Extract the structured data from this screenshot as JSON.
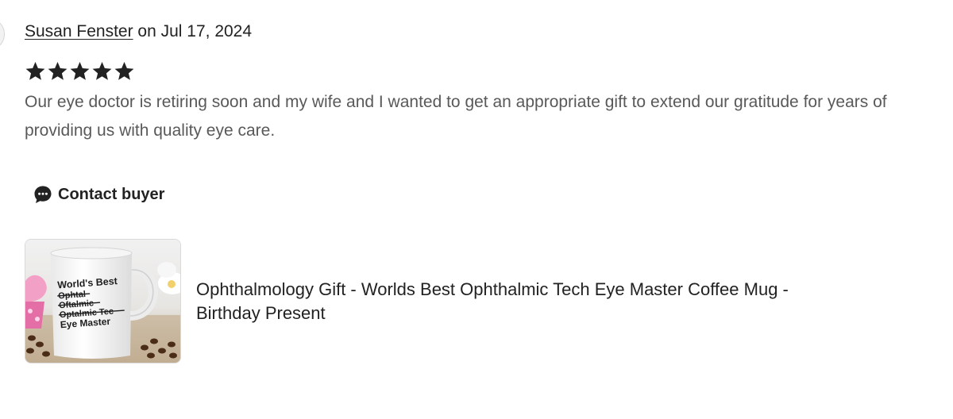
{
  "review": {
    "reviewer_name": "Susan Fenster",
    "date_prefix": " on ",
    "date": "Jul 17, 2024",
    "rating": 5,
    "rating_max": 5,
    "text": "Our eye doctor is retiring soon and my wife and I wanted to get an appropriate gift to extend our gratitude for years of providing us with quality eye care."
  },
  "actions": {
    "contact_label": "Contact buyer",
    "contact_icon": "chat-bubble-icon"
  },
  "product": {
    "title": "Ophthalmology Gift - Worlds Best Ophthalmic Tech Eye Master Coffee Mug - Birthday Present",
    "image_text": [
      "World's Best",
      "Ophtal",
      "Oftalmic",
      "Optalmic Tec",
      "Eye Master"
    ]
  },
  "colors": {
    "star": "#222222",
    "review_text": "#595959",
    "text": "#222222"
  }
}
